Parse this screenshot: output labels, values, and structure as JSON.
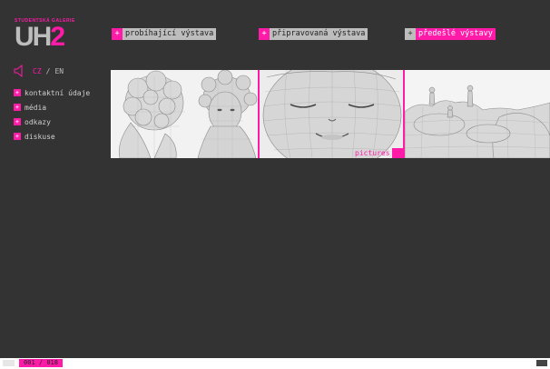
{
  "brand": {
    "tagline": "STUDENTSKÁ GALERIE",
    "logo_main": "UH",
    "logo_number": "2"
  },
  "language": {
    "current": "CZ",
    "separator": "/",
    "alternate": "EN"
  },
  "sidebar": {
    "items": [
      {
        "label": "kontaktní údaje"
      },
      {
        "label": "média"
      },
      {
        "label": "odkazy"
      },
      {
        "label": "diskuse"
      }
    ]
  },
  "topnav": {
    "items": [
      {
        "plus": "+",
        "label": "probíhající výstava"
      },
      {
        "plus": "+",
        "label": "připravovaná výstava"
      },
      {
        "plus": "+",
        "label": "předešlé výstavy"
      }
    ]
  },
  "gallery": {
    "caption": "pictures"
  },
  "footer": {
    "counter": "001 / 018"
  },
  "colors": {
    "accent": "#ff1aa8",
    "background": "#333333",
    "tab": "#bdbdbd"
  }
}
